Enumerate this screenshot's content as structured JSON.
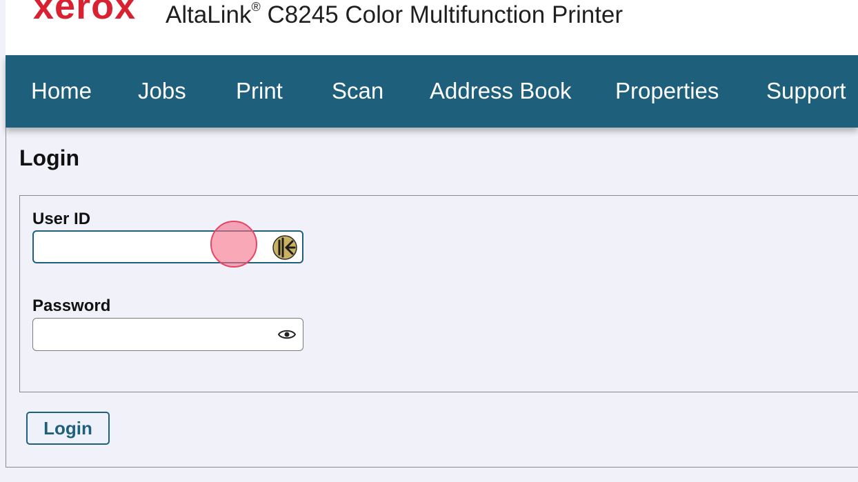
{
  "header": {
    "logo_text": "xerox",
    "product_name": "AltaLink",
    "product_mark": "®",
    "product_model": "C8245 Color Multifunction Printer"
  },
  "nav": {
    "items": [
      {
        "label": "Home"
      },
      {
        "label": "Jobs"
      },
      {
        "label": "Print"
      },
      {
        "label": "Scan"
      },
      {
        "label": "Address Book"
      },
      {
        "label": "Properties"
      },
      {
        "label": "Support"
      }
    ]
  },
  "login": {
    "title": "Login",
    "user_id_label": "User ID",
    "user_id_value": "",
    "password_label": "Password",
    "password_value": "",
    "button_label": "Login"
  },
  "icons": {
    "user_id_field_icon": "keeper-password-manager-icon",
    "password_field_icon": "eye-icon"
  },
  "colors": {
    "brand_red": "#d92231",
    "nav_background": "#1e5f7c",
    "page_background": "#f1f2f9",
    "accent": "#1e5f7c",
    "keeper_icon": "#c9b25f"
  }
}
